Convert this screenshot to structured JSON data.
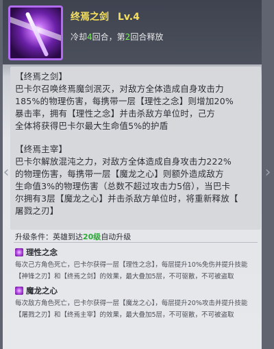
{
  "skill": {
    "name": "终焉之剑",
    "level": "Lv.4",
    "cooldown_prefix": "冷却",
    "cooldown_value": "4",
    "cooldown_mid": "回合，第",
    "cooldown_first": "2",
    "cooldown_suffix": "回合释放"
  },
  "description": {
    "section1_title": "【终焉之剑】",
    "section1_lines": [
      "巴卡尔召唤终焉魔剑泯灭，对敌方全体造成自身攻击力",
      "185%的物理伤害，每携带一层【理性之念】则增加20%",
      "暴击率，拥有【理性之念】并击杀敌方单位时，己方",
      "全体将获得巴卡尔最大生命值5%的护盾"
    ],
    "section2_title": "【终焉主宰】",
    "section2_lines": [
      "巴卡尔解放混沌之力，对敌方全体造成自身攻击力222%",
      "的物理伤害，每携带一层【魔龙之心】则额外造成敌方",
      "生命值3%的物理伤害（总数不超过攻击力5倍），当巴卡",
      "尔拥有3层【魔龙之心】并击杀敌方单位时，将重新释放【",
      "屠戮之刃】"
    ]
  },
  "upgrade": {
    "label": "升级条件：英雄到达",
    "level": "20级",
    "suffix": "自动升级"
  },
  "passives": [
    {
      "name": "理性之念",
      "lines": [
        "每次己方角色死亡，巴卡尔获得一层【理性之念】，每层提升10%免伤并提升技能",
        "【神锋之刃】和【终焉之剑】的效果，最大叠加5层，不可驱散，不可被盗取"
      ]
    },
    {
      "name": "魔龙之心",
      "lines": [
        "每次敌方角色死亡，巴卡尔获得一层【魔龙之心】，每层提升20%攻击并提升技能",
        "【屠戮之刃】和【终焉主宰】的效果，最大叠加5层，不可驱散，不可被盗取"
      ]
    }
  ],
  "colors": {
    "title": "#f6e05e",
    "highlight_green": "#7cf05a",
    "upgrade_level": "#2fa83a"
  }
}
